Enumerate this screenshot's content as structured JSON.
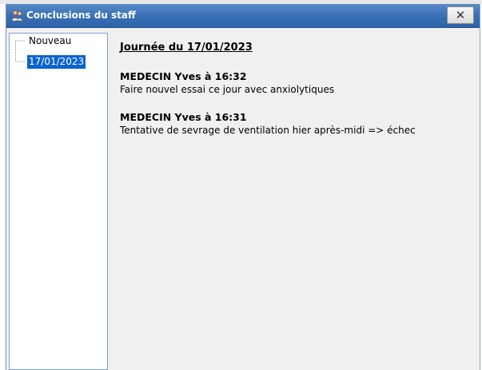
{
  "window": {
    "title": "Conclusions du staff",
    "close_label": "✕"
  },
  "tree": {
    "items": [
      {
        "label": "Nouveau",
        "selected": false
      },
      {
        "label": "17/01/2023",
        "selected": true
      }
    ]
  },
  "content": {
    "day_heading": "Journée du 17/01/2023",
    "entries": [
      {
        "author": "MEDECIN Yves à 16:32",
        "text": "Faire nouvel essai ce jour avec anxiolytiques"
      },
      {
        "author": "MEDECIN Yves à 16:31",
        "text": "Tentative de sevrage de ventilation hier après-midi => échec"
      }
    ]
  },
  "colors": {
    "titlebar": "#3b73b8",
    "selection": "#0a63d1",
    "window_bg": "#f0f0f0"
  },
  "icons": {
    "title": "staff-people-icon",
    "close": "close-icon"
  }
}
